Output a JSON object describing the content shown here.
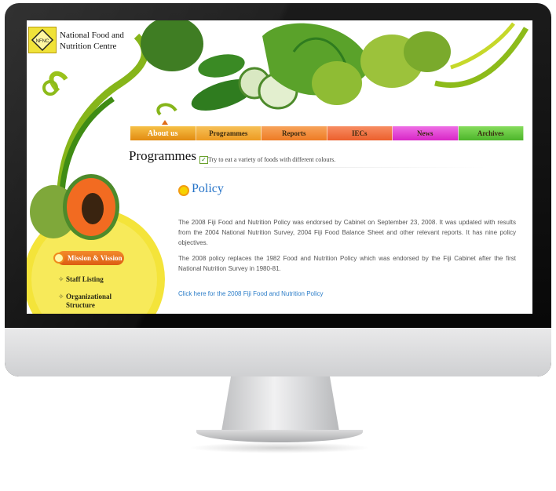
{
  "site": {
    "logo_title_line1": "National Food and",
    "logo_title_line2": "Nutrition Centre"
  },
  "nav": {
    "items": [
      {
        "label": "About us",
        "color": "#f0a51e"
      },
      {
        "label": "Programmes",
        "color": "#f2a52e"
      },
      {
        "label": "Reports",
        "color": "#f3892f"
      },
      {
        "label": "IECs",
        "color": "#f46a3a"
      },
      {
        "label": "News",
        "color": "#e53bd3"
      },
      {
        "label": "Archives",
        "color": "#5fc33b"
      }
    ]
  },
  "section": {
    "title": "Programmes",
    "tip": "Try to eat a variety of foods with different colours."
  },
  "policy": {
    "heading": "Policy",
    "paragraph1": "The 2008 Fiji Food and Nutrition Policy was endorsed by Cabinet on September 23, 2008. It was updated with results from the 2004 National Nutrition Survey, 2004 Fiji Food Balance Sheet and other relevant reports. It has nine policy objectives.",
    "paragraph2": "The 2008 policy replaces the 1982 Food and Nutrition Policy which was endorsed by the Fiji Cabinet after the first National Nutrition Survey in 1980-81.",
    "link": "Click here for the 2008 Fiji Food and Nutrition Policy"
  },
  "sidebar": {
    "button": "Mission & Vission",
    "links": [
      "Staff Listing",
      "Organizational Structure"
    ]
  },
  "logo": {
    "acronym": "NFNC"
  }
}
